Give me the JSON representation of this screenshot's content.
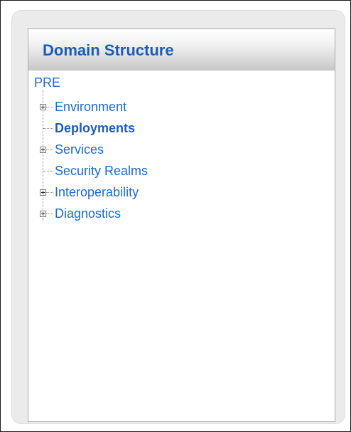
{
  "portlet": {
    "title": "Domain Structure"
  },
  "tree": {
    "root_label": "PRE",
    "nodes": [
      {
        "label": "Environment",
        "expandable": true,
        "bold": false
      },
      {
        "label": "Deployments",
        "expandable": false,
        "bold": true
      },
      {
        "label": "Services",
        "expandable": true,
        "bold": false
      },
      {
        "label": "Security Realms",
        "expandable": false,
        "bold": false
      },
      {
        "label": "Interoperability",
        "expandable": true,
        "bold": false
      },
      {
        "label": "Diagnostics",
        "expandable": true,
        "bold": false
      }
    ]
  },
  "colors": {
    "title": "#1d5db1",
    "link": "#1d6ac8",
    "tree_lines": "#8a8a8a"
  }
}
